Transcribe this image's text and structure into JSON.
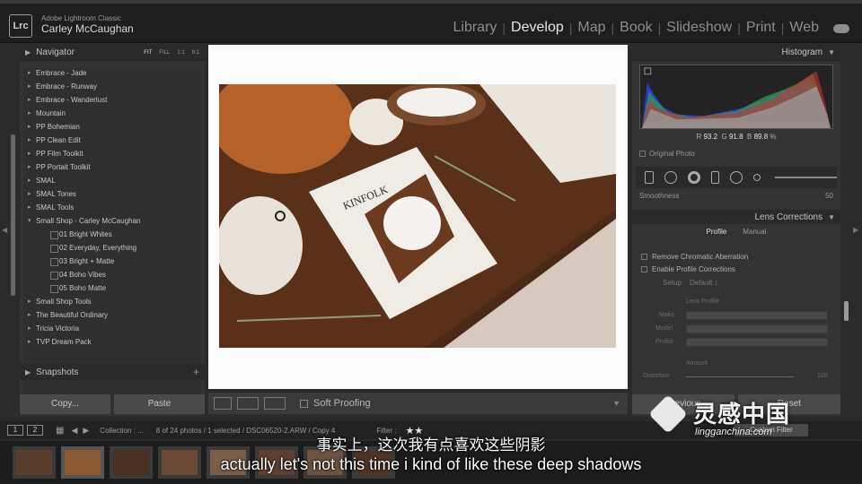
{
  "identity": {
    "logo": "Lrc",
    "app_name": "Adobe Lightroom Classic",
    "user": "Carley McCaughan"
  },
  "modules": [
    {
      "label": "Library",
      "active": false
    },
    {
      "label": "Develop",
      "active": true
    },
    {
      "label": "Map",
      "active": false
    },
    {
      "label": "Book",
      "active": false
    },
    {
      "label": "Slideshow",
      "active": false
    },
    {
      "label": "Print",
      "active": false
    },
    {
      "label": "Web",
      "active": false
    }
  ],
  "navigator": {
    "title": "Navigator",
    "zoom": [
      "FIT",
      "FILL",
      "1:1",
      "8:1"
    ]
  },
  "presets": [
    {
      "label": "Embrace - Jade",
      "level": 0
    },
    {
      "label": "Embrace - Runway",
      "level": 0
    },
    {
      "label": "Embrace - Wanderlust",
      "level": 0
    },
    {
      "label": "Mountain",
      "level": 0
    },
    {
      "label": "PP Bohemian",
      "level": 0
    },
    {
      "label": "PP Clean Edit",
      "level": 0
    },
    {
      "label": "PP Film Toolkit",
      "level": 0
    },
    {
      "label": "PP Portait Toolkit",
      "level": 0
    },
    {
      "label": "SMAL",
      "level": 0
    },
    {
      "label": "SMAL Tones",
      "level": 0
    },
    {
      "label": "SMAL Tools",
      "level": 0
    },
    {
      "label": "Small Shop - Carley McCaughan",
      "level": 0,
      "open": true
    },
    {
      "label": "01 Bright Whites",
      "level": 1
    },
    {
      "label": "02 Everyday, Everything",
      "level": 1
    },
    {
      "label": "03 Bright + Matte",
      "level": 1
    },
    {
      "label": "04 Boho Vibes",
      "level": 1
    },
    {
      "label": "05 Boho Matte",
      "level": 1
    },
    {
      "label": "Small Shop Tools",
      "level": 0
    },
    {
      "label": "The Beautiful Ordinary",
      "level": 0
    },
    {
      "label": "Tricia Victoria",
      "level": 0
    },
    {
      "label": "TVP Dream Pack",
      "level": 0
    }
  ],
  "snapshots": {
    "title": "Snapshots",
    "add": "+"
  },
  "left_buttons": {
    "copy": "Copy...",
    "paste": "Paste"
  },
  "toolbar": {
    "soft_proofing": "Soft Proofing"
  },
  "histogram": {
    "title": "Histogram",
    "r_label": "R",
    "r_value": "93.2",
    "g_label": "G",
    "g_value": "91.8",
    "b_label": "B",
    "b_value": "89.8",
    "unit": "%",
    "original_photo": "Original Photo"
  },
  "smoothness": {
    "label": "Smoothness",
    "value": "50"
  },
  "lens_corrections": {
    "title": "Lens Corrections",
    "tab_profile": "Profile",
    "tab_manual": "Manual",
    "remove_ca": "Remove Chromatic Aberration",
    "enable_profile": "Enable Profile Corrections",
    "setup_label": "Setup",
    "setup_value": "Default ↕",
    "lens_profile": "Lens Profile",
    "make_label": "Make",
    "model_label": "Model",
    "profile_label": "Profile",
    "amount": "Amount",
    "distortion_label": "Distortion",
    "distortion_value": "100"
  },
  "right_buttons": {
    "previous": "Previous",
    "reset": "Reset"
  },
  "filmstrip": {
    "page1": "1",
    "page2": "2",
    "collection": "Collection : ...",
    "info": "8 of 24 photos / 1 selected / DSC06520-2.ARW / Copy 4",
    "filter": "Filter :",
    "stars": "★★",
    "custom_filter": "Custom Filter"
  },
  "subtitles": {
    "zh": "事实上，这次我有点喜欢这些阴影",
    "en": "actually let's not this time i kind of like these deep shadows"
  },
  "watermark": {
    "zh": "灵感中国",
    "en": "lingganchina.com"
  }
}
